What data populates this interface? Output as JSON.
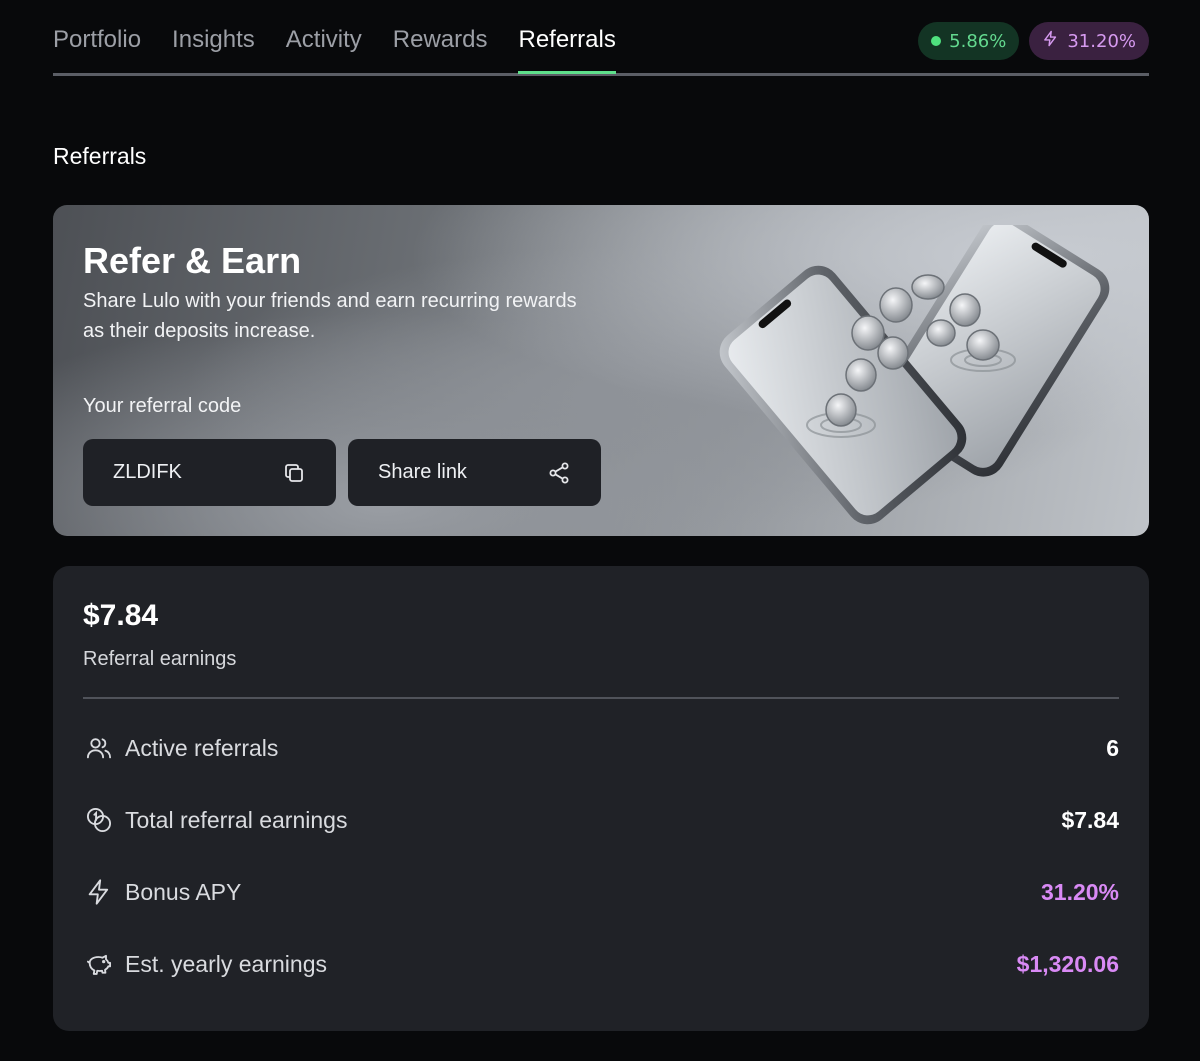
{
  "nav": {
    "tabs": [
      {
        "label": "Portfolio"
      },
      {
        "label": "Insights"
      },
      {
        "label": "Activity"
      },
      {
        "label": "Rewards"
      },
      {
        "label": "Referrals",
        "active": true
      }
    ],
    "badges": {
      "apy": "5.86%",
      "bonus": "31.20%"
    }
  },
  "page": {
    "title": "Referrals"
  },
  "hero": {
    "title": "Refer & Earn",
    "description": "Share Lulo with your friends and earn recurring rewards as their deposits increase.",
    "code_label": "Your referral code",
    "code": "ZLDIFK",
    "share_label": "Share link"
  },
  "stats": {
    "total_amount": "$7.84",
    "total_label": "Referral earnings",
    "rows": [
      {
        "icon": "users-icon",
        "label": "Active referrals",
        "value": "6"
      },
      {
        "icon": "coins-icon",
        "label": "Total referral earnings",
        "value": "$7.84"
      },
      {
        "icon": "lightning-icon",
        "label": "Bonus APY",
        "value": "31.20%"
      },
      {
        "icon": "piggy-bank-icon",
        "label": "Est. yearly earnings",
        "value": "$1,320.06"
      }
    ]
  },
  "colors": {
    "background": "#08090b",
    "card": "#202227",
    "active_tab_underline": "#5ee08b",
    "green_badge_text": "#63d98f",
    "purple_accent": "#d98af5"
  }
}
